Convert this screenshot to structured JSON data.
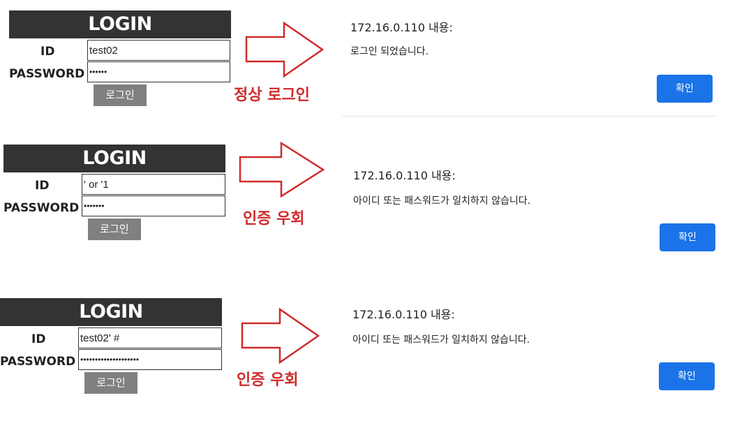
{
  "colors": {
    "header_bg": "#333333",
    "login_button_bg": "#808080",
    "ok_button_bg": "#1a73e8",
    "arrow_red": "#d02a2a"
  },
  "panels": [
    {
      "login": {
        "header": "LOGIN",
        "id_label": "ID",
        "password_label": "PASSWORD",
        "id_value": "test02",
        "password_value": "••••••",
        "button_label": "로그인"
      },
      "caption": "정상 로그인",
      "alert": {
        "title": "172.16.0.110 내용:",
        "message": "로그인 되었습니다.",
        "button_label": "확인"
      }
    },
    {
      "login": {
        "header": "LOGIN",
        "id_label": "ID",
        "password_label": "PASSWORD",
        "id_value": "' or '1",
        "password_value": "•••••••",
        "button_label": "로그인"
      },
      "caption": "인증 우회",
      "alert": {
        "title": "172.16.0.110 내용:",
        "message": "아이디 또는 패스워드가 일치하지 않습니다.",
        "button_label": "확인"
      }
    },
    {
      "login": {
        "header": "LOGIN",
        "id_label": "ID",
        "password_label": "PASSWORD",
        "id_value": "test02' #",
        "password_value": "••••••••••••••••••••",
        "button_label": "로그인"
      },
      "caption": "인증 우회",
      "alert": {
        "title": "172.16.0.110 내용:",
        "message": "아이디 또는 패스워드가 일치하지 않습니다.",
        "button_label": "확인"
      }
    }
  ]
}
